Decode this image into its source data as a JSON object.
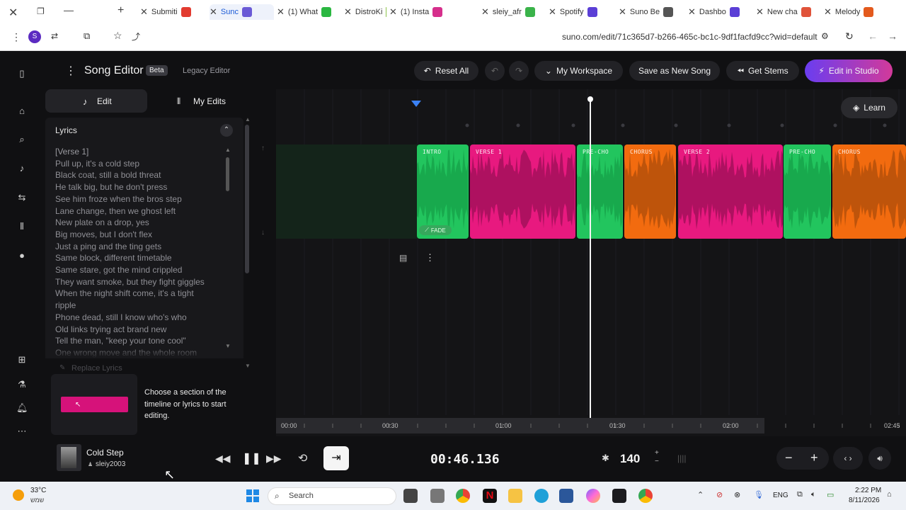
{
  "browser": {
    "tabs": [
      {
        "label": "Submiti",
        "color": "#e23b30"
      },
      {
        "label": "Sunc",
        "color": "#6a5ad6",
        "active": true
      },
      {
        "label": "(1) What",
        "color": "#2bb741"
      },
      {
        "label": "DistroKi",
        "color": "#8bc34a"
      },
      {
        "label": "(1) Insta",
        "color": "#d62f8c"
      },
      {
        "label": "sleiy_afr",
        "color": "#3ab34a"
      },
      {
        "label": "Spotify",
        "color": "#5b3fd6"
      },
      {
        "label": "Suno Be",
        "color": "#555555"
      },
      {
        "label": "Dashbo",
        "color": "#5b3fd6"
      },
      {
        "label": "New cha",
        "color": "#e0533a"
      },
      {
        "label": "Melody",
        "color": "#e35a1d"
      }
    ],
    "url": "suno.com/edit/71c365d7-b266-465c-bc1c-9df1facfd9cc?wid=default",
    "profile_initial": "S"
  },
  "header": {
    "title": "Song Editor",
    "beta": "Beta",
    "legacy": "Legacy Editor",
    "reset_all": "Reset All",
    "workspace": "My Workspace",
    "save_new": "Save as New Song",
    "get_stems": "Get Stems",
    "edit_studio": "Edit in Studio"
  },
  "left": {
    "tab_edit": "Edit",
    "tab_my_edits": "My Edits",
    "lyrics_title": "Lyrics",
    "lyrics": [
      "[Verse 1]",
      "Pull up, it's a cold step",
      "Black coat, still a bold threat",
      "He talk big, but he don't press",
      "See him froze when the bros step",
      "Lane change, then we ghost left",
      "New plate on a drop, yes",
      "Big moves, but I don't flex",
      "Just a ping and the ting gets",
      "Same block, different timetable",
      "Same stare, got the mind crippled",
      "They want smoke, but they fight giggles",
      "When the night shift come, it's a tight",
      "ripple",
      "Phone dead, still I know who's who",
      "Old links trying act brand new",
      "Tell the man, \"keep your tone cool\"",
      "One wrong move and the whole room"
    ],
    "replace_lyrics": "Replace Lyrics",
    "hint": "Choose a section of the timeline or lyrics to start editing."
  },
  "timeline": {
    "learn": "Learn",
    "sections": [
      {
        "label": "INTRO",
        "color": "#22c55e",
        "wave": "#16a34a"
      },
      {
        "label": "VERSE 1",
        "color": "#e8197f",
        "wave": "#a3105a"
      },
      {
        "label": "PRE-CHO",
        "color": "#22c55e",
        "wave": "#16a34a"
      },
      {
        "label": "CHORUS",
        "color": "#f26b0f",
        "wave": "#b5500a"
      },
      {
        "label": "VERSE 2",
        "color": "#e8197f",
        "wave": "#a3105a"
      },
      {
        "label": "PRE-CHO",
        "color": "#22c55e",
        "wave": "#16a34a"
      },
      {
        "label": "CHORUS",
        "color": "#f26b0f",
        "wave": "#b5500a"
      }
    ],
    "fade": "FADE",
    "ruler": [
      "00:00",
      "00:30",
      "01:00",
      "01:30",
      "02:00",
      "02:45"
    ]
  },
  "player": {
    "song_title": "Cold Step",
    "artist": "sleiy2003",
    "time": "00:46.136",
    "bpm": "140"
  },
  "taskbar": {
    "temp": "33°C",
    "weather": "שמש",
    "search": "Search",
    "lang": "ENG",
    "time": "2:22 PM",
    "date": "8/11/2026"
  }
}
